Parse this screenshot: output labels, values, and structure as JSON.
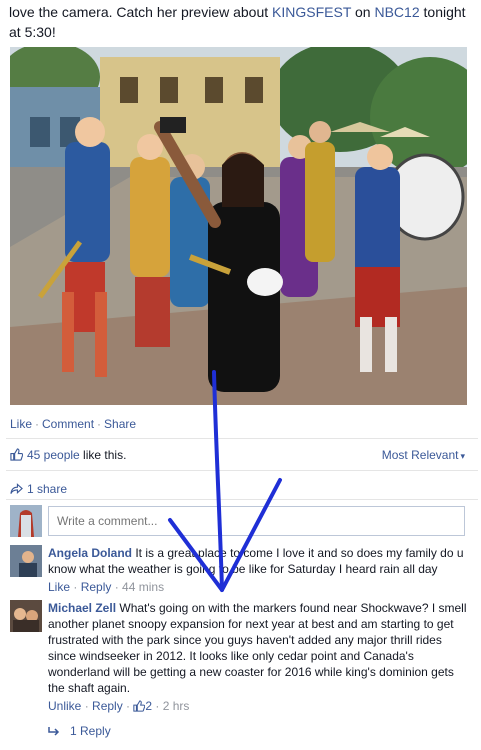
{
  "post": {
    "text_part1": "love the camera. Catch her preview about ",
    "link1": "KINGSFEST",
    "text_part2": " on ",
    "link2": "NBC12",
    "text_part3": " tonight at 5:30!"
  },
  "actions": {
    "like": "Like",
    "comment": "Comment",
    "share": "Share",
    "separator": "·"
  },
  "likes": {
    "count_text": "45 people",
    "suffix": " like this.",
    "sort_label": "Most Relevant",
    "sort_caret": "▾"
  },
  "shares": {
    "icon": "share-arrow-icon",
    "text": "1 share"
  },
  "comment_input": {
    "placeholder": "Write a comment..."
  },
  "comments": [
    {
      "name": "Angela Doland",
      "text": " It is a great place to come I love it and so does my family do u know what the weather is going to be like for Saturday I heard rain all day",
      "like": "Like",
      "reply": "Reply",
      "time": "44 mins"
    },
    {
      "name": "Michael Zell",
      "text": " What's going on with the markers found near Shockwave? I smell another planet snoopy expansion for next year at best and am starting to get frustrated with the park since you guys haven't added any major thrill rides since windseeker in 2012. It looks like only cedar point and Canada's wonderland will be getting a new coaster for 2016 while king's dominion gets the shaft again.",
      "like": "Unlike",
      "reply": "Reply",
      "like_count": "2",
      "time": "2 hrs"
    }
  ],
  "replies": {
    "text": "1 Reply"
  },
  "colors": {
    "link": "#3b5998",
    "arrow": "#1f2fd6"
  }
}
